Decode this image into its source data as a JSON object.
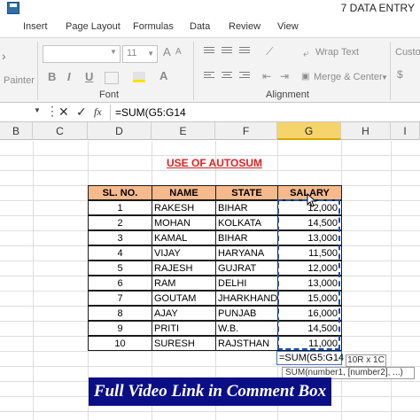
{
  "window": {
    "title": "7 DATA ENTRY"
  },
  "tabs": [
    "Insert",
    "Page Layout",
    "Formulas",
    "Data",
    "Review",
    "View"
  ],
  "ribbon": {
    "painter_label": "Painter",
    "font_size": "11",
    "font_group_label": "Font",
    "wrap_text": "Wrap Text",
    "merge_center": "Merge & Center",
    "alignment_group_label": "Alignment",
    "number_format": "Custo",
    "bold": "B",
    "italic": "I",
    "underline": "U"
  },
  "formula_bar": {
    "fx": "fx",
    "formula": "=SUM(G5:G14"
  },
  "columns": [
    {
      "letter": "B",
      "selected": false
    },
    {
      "letter": "C",
      "selected": false
    },
    {
      "letter": "D",
      "selected": false
    },
    {
      "letter": "E",
      "selected": false
    },
    {
      "letter": "F",
      "selected": false
    },
    {
      "letter": "G",
      "selected": true
    },
    {
      "letter": "H",
      "selected": false
    },
    {
      "letter": "I",
      "selected": false
    }
  ],
  "sheet": {
    "heading": "USE OF AUTOSUM",
    "headers": [
      "SL. NO.",
      "NAME",
      "STATE",
      "SALARY"
    ],
    "rows": [
      {
        "sl": "1",
        "name": "RAKESH",
        "state": "BIHAR",
        "salary": "12,000"
      },
      {
        "sl": "2",
        "name": "MOHAN",
        "state": "KOLKATA",
        "salary": "14,500"
      },
      {
        "sl": "3",
        "name": "KAMAL",
        "state": "BIHAR",
        "salary": "13,000"
      },
      {
        "sl": "4",
        "name": "VIJAY",
        "state": "HARYANA",
        "salary": "11,500"
      },
      {
        "sl": "5",
        "name": "RAJESH",
        "state": "GUJRAT",
        "salary": "12,000"
      },
      {
        "sl": "6",
        "name": "RAM",
        "state": "DELHI",
        "salary": "13,000"
      },
      {
        "sl": "7",
        "name": "GOUTAM",
        "state": "JHARKHAND",
        "salary": "15,000"
      },
      {
        "sl": "8",
        "name": "AJAY",
        "state": "PUNJAB",
        "salary": "16,000"
      },
      {
        "sl": "9",
        "name": "PRITI",
        "state": "W.B.",
        "salary": "14,500"
      },
      {
        "sl": "10",
        "name": "SURESH",
        "state": "RAJSTHAN",
        "salary": "11,000"
      }
    ],
    "active_cell_formula": "=SUM(G5:G14",
    "size_tooltip": "10R x 1C",
    "args_tooltip": "SUM(number1, [number2], ...)"
  },
  "banner": {
    "text": "Full Video Link in Comment Box"
  },
  "colors": {
    "header_fill": "#f5b98c",
    "heading_red": "#e02020",
    "banner_bg": "#0b0f86",
    "selected_col": "#f6d46c"
  }
}
